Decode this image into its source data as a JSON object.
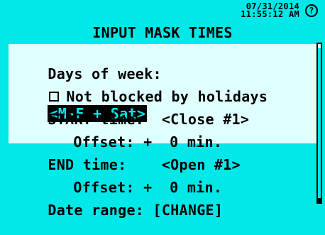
{
  "header": {
    "date": "07/31/2014",
    "time": "11:55:12 AM",
    "help_icon": "?"
  },
  "title": "INPUT MASK TIMES",
  "rows": [
    {
      "label": "Days of week:",
      "value": "<M-F + Sat>"
    },
    {
      "label": "Not blocked by holidays",
      "checked": false
    },
    {
      "label": "START time:",
      "value": "<Close #1>"
    },
    {
      "label": "Offset:",
      "sign": "+",
      "value": "0 min."
    },
    {
      "label": "END time:",
      "value": "<Open #1>"
    },
    {
      "label": "Offset:",
      "sign": "+",
      "value": "0 min."
    },
    {
      "label": "Date range:",
      "value": "[CHANGE]"
    }
  ],
  "colors": {
    "background": "#00e8e8",
    "selected_row": "#e0ffff",
    "text": "#000000"
  }
}
